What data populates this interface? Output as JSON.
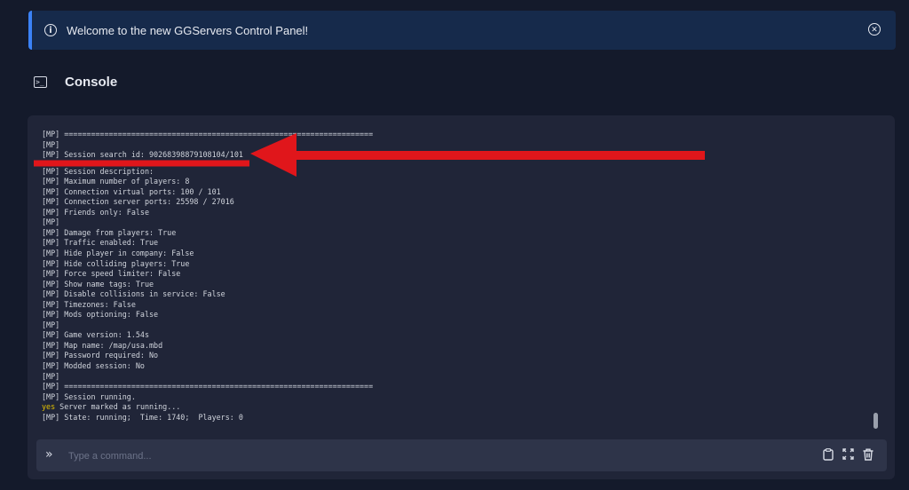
{
  "banner": {
    "text": "Welcome to the new GGServers Control Panel!",
    "info_icon": "info-circle-icon",
    "close_icon": "close-circle-icon",
    "accent_color": "#3b82f6"
  },
  "heading": {
    "title": "Console",
    "icon": "terminal-icon"
  },
  "console": {
    "lines": [
      "[MP] =====================================================================",
      "[MP]",
      "[MP] Session search id: 90268398879108104/101",
      "",
      "[MP] Session description:",
      "[MP] Maximum number of players: 8",
      "[MP] Connection virtual ports: 100 / 101",
      "[MP] Connection server ports: 25598 / 27016",
      "[MP] Friends only: False",
      "[MP]",
      "[MP] Damage from players: True",
      "[MP] Traffic enabled: True",
      "[MP] Hide player in company: False",
      "[MP] Hide colliding players: True",
      "[MP] Force speed limiter: False",
      "[MP] Show name tags: True",
      "[MP] Disable collisions in service: False",
      "[MP] Timezones: False",
      "[MP] Mods optioning: False",
      "[MP]",
      "[MP] Game version: 1.54s",
      "[MP] Map name: /map/usa.mbd",
      "[MP] Password required: No",
      "[MP] Modded session: No",
      "[MP]",
      "[MP] =====================================================================",
      "[MP] Session running.",
      "yes Server marked as running...",
      "[MP] State: running;  Time: 1740;  Players: 0"
    ],
    "yes_color": "#e5c100"
  },
  "command": {
    "placeholder": "Type a command...",
    "prompt_icon": "chevrons-right-icon",
    "tools": [
      "clipboard-icon",
      "expand-icon",
      "trash-icon"
    ]
  },
  "annotation": {
    "arrow_color": "#e0161b"
  }
}
